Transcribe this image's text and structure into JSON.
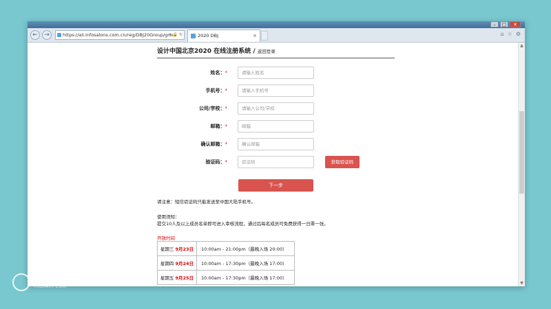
{
  "browser": {
    "address": "https://ali.infosalons.com.cn/reg/DBJ20Group/grou",
    "tab_title": "2020 DBJ",
    "tab_close": "×",
    "back": "←",
    "forward": "→",
    "address_tools": "▾ 🔒 ↻"
  },
  "header": {
    "title": "设计中国北京2020 在线注册系统",
    "separator": " / ",
    "sub": "返回登录"
  },
  "form": {
    "required_mark": "*",
    "fields": [
      {
        "label": "姓名：",
        "placeholder": "请输入姓名",
        "req": "*"
      },
      {
        "label": "手机号：",
        "placeholder": "请输入手机号",
        "req": "*"
      },
      {
        "label": "公司/学校：",
        "placeholder": "请输入公司/学校",
        "req": "*"
      },
      {
        "label": "邮箱：",
        "placeholder": "邮箱",
        "req": "*"
      },
      {
        "label": "确认邮箱：",
        "placeholder": "确认邮箱",
        "req": "*"
      },
      {
        "label": "验证码：",
        "placeholder": "验证码",
        "req": "*"
      }
    ],
    "get_code_button": "获取验证码",
    "next_button": "下一步"
  },
  "notes": {
    "sms_notice": "请注意：短信验证码只能发送至中国大陆手机号。",
    "usage_title": "使用须知：",
    "usage_text": "提交10人及以上成员名单即可进入审核流程，通过后每名成员可免费获得一日票一张。"
  },
  "opening": {
    "title": "开放时间",
    "rows": [
      {
        "weekday": "星期三 ",
        "date": "9月23日",
        "time": "10:00am - 21:00pm（最晚入场 20:00）"
      },
      {
        "weekday": "星期四 ",
        "date": "9月24日",
        "time": "10:00am - 17:30pm（最晚入场 17:00）"
      },
      {
        "weekday": "星期五 ",
        "date": "9月25日",
        "time": "10:00am - 17:30pm（最晚入场 17:00）"
      }
    ]
  },
  "watermark": {
    "cn": "搜艺公会",
    "en": "TRUEART.COM"
  }
}
